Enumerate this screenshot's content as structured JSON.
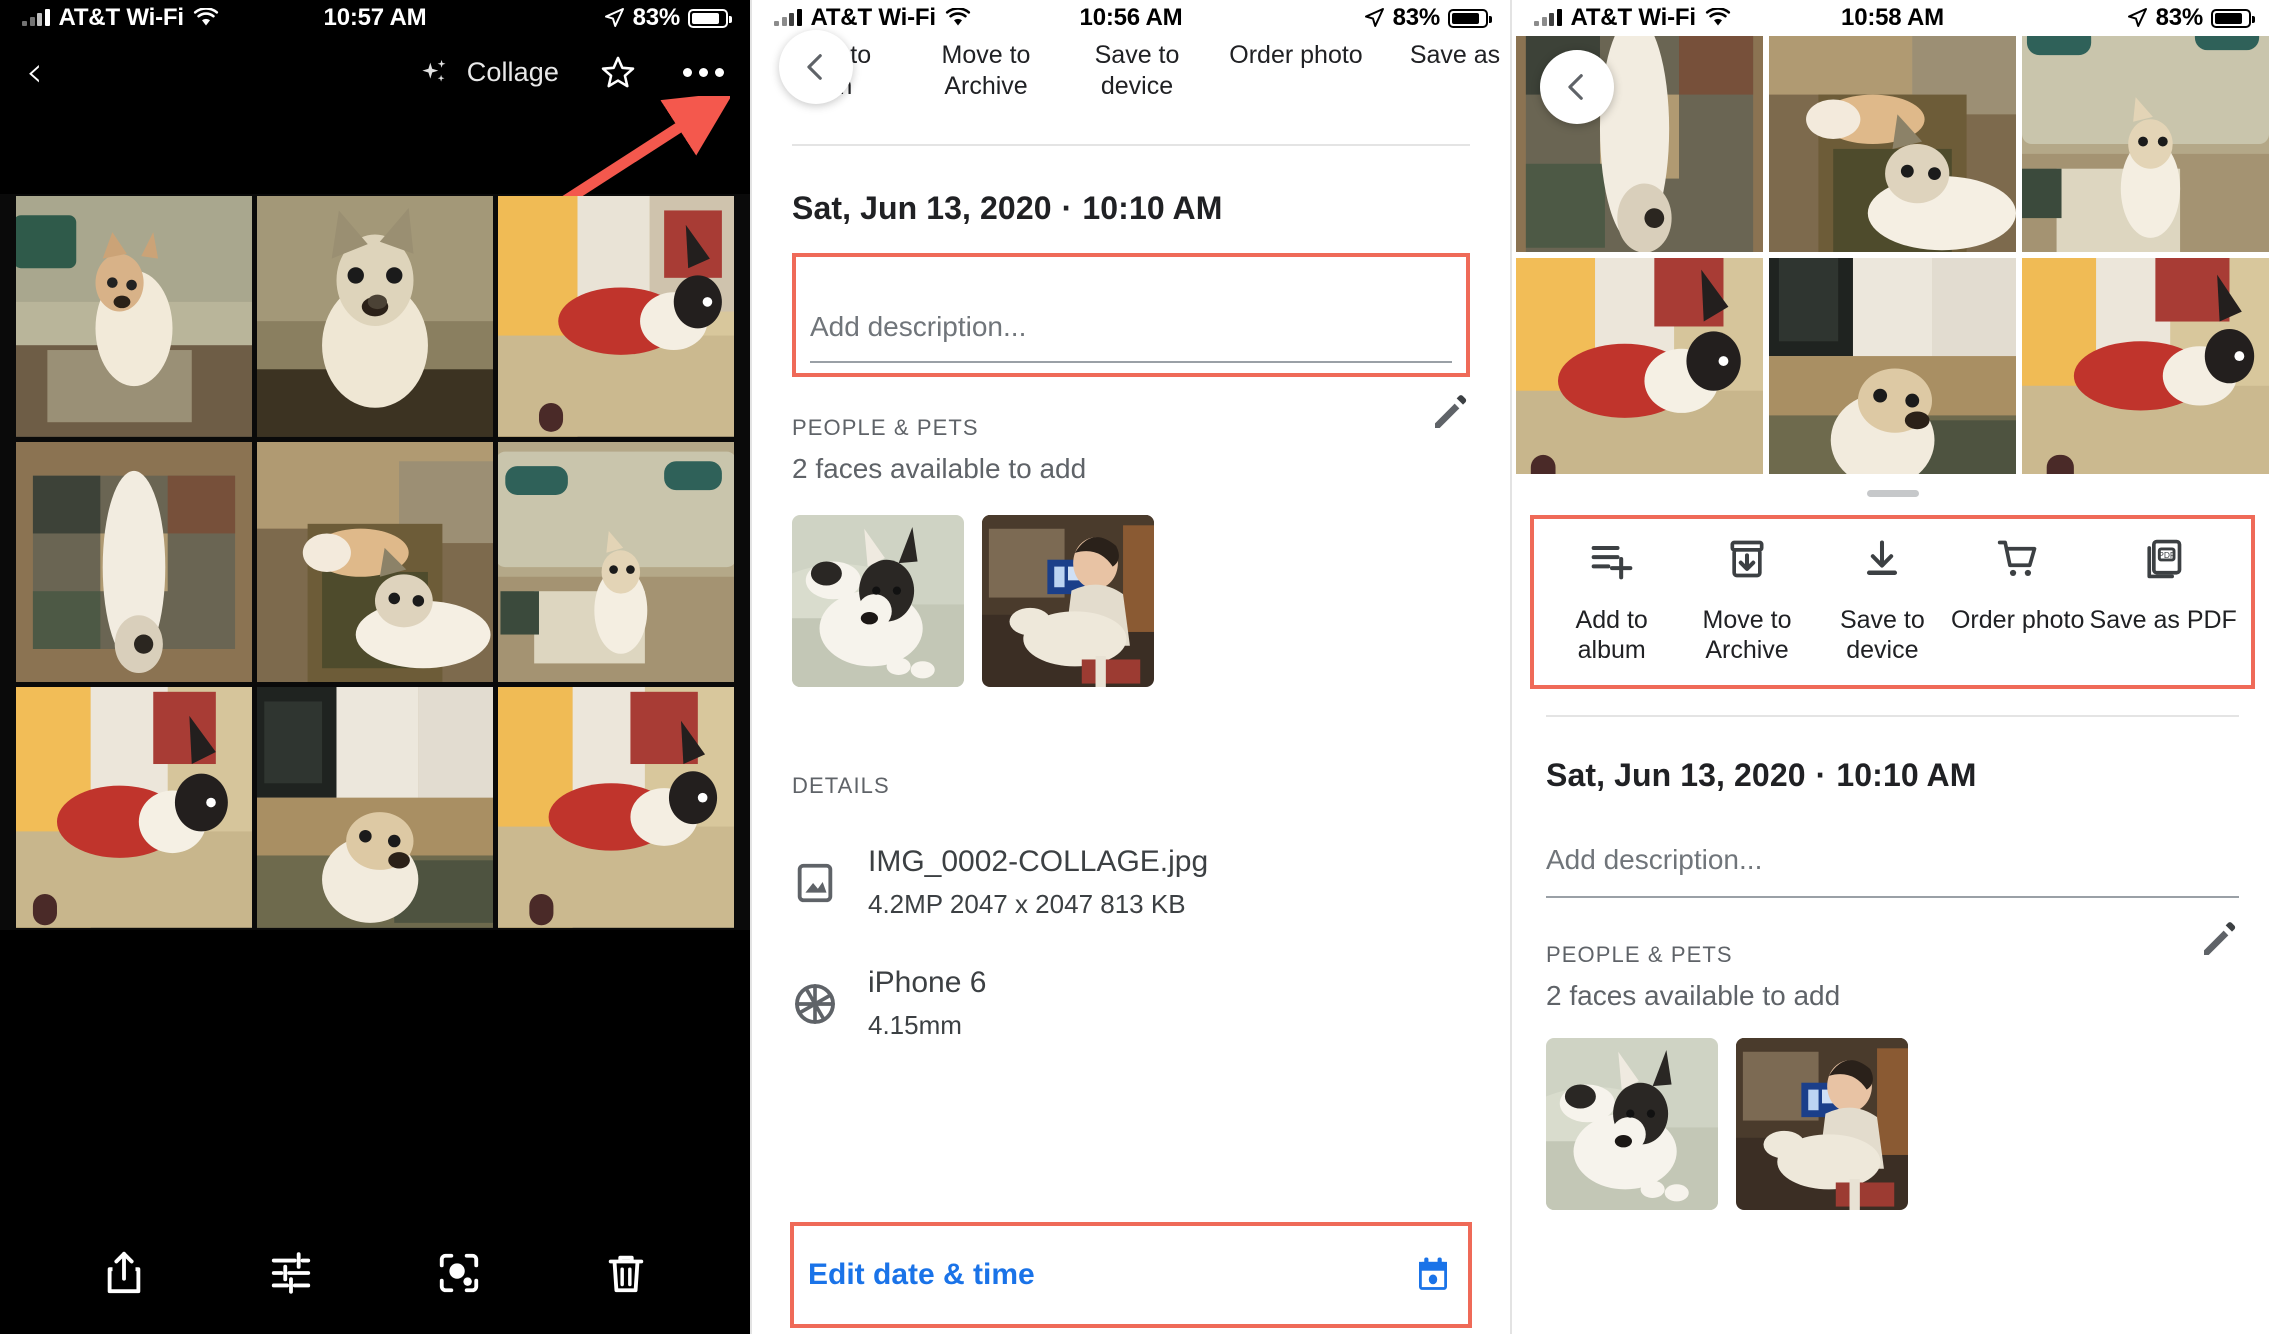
{
  "panel1": {
    "status": {
      "carrier": "AT&T Wi-Fi",
      "time": "10:57 AM",
      "battery": "83%"
    },
    "topbar": {
      "back_icon": "chevron-left-icon",
      "sparkle_icon": "sparkle-icon",
      "title": "Collage",
      "star_icon": "star-outline-icon",
      "more_icon": "more-horizontal-icon"
    },
    "annotation": {
      "arrow_color": "#f4584d",
      "points_to": "more-horizontal-icon"
    },
    "toolbar": {
      "share_label": "Share",
      "edit_label": "Edit",
      "lens_label": "Lens",
      "delete_label": "Delete"
    }
  },
  "panel2": {
    "status": {
      "carrier": "AT&T Wi-Fi",
      "time": "10:56 AM",
      "battery": "83%"
    },
    "actions": [
      {
        "label": "Add to\nalbum",
        "line1": "Add to",
        "line2": "um"
      },
      {
        "label": "Move to Archive",
        "line1": "Move to",
        "line2": "Archive"
      },
      {
        "label": "Save to device",
        "line1": "Save to",
        "line2": "device"
      },
      {
        "label": "Order photo",
        "line1": "Order photo",
        "line2": ""
      },
      {
        "label": "Save as PDF",
        "line1": "Save as",
        "line2": ""
      }
    ],
    "back_icon": "chevron-left-icon",
    "datetime": {
      "date": "Sat, Jun 13, 2020",
      "separator": "·",
      "time": "10:10 AM"
    },
    "description_placeholder": "Add description...",
    "people_pets": {
      "label": "PEOPLE & PETS",
      "subtitle": "2 faces available to add",
      "edit_icon": "pencil-icon",
      "faces": [
        "face-thumbnail-dog",
        "face-thumbnail-person"
      ]
    },
    "details": {
      "label": "DETAILS",
      "rows": [
        {
          "icon": "image-icon",
          "title": "IMG_0002-COLLAGE.jpg",
          "subtitle": "4.2MP   2047 x 2047   813 KB"
        },
        {
          "icon": "aperture-icon",
          "title": "iPhone 6",
          "subtitle": "4.15mm"
        }
      ]
    },
    "edit_date_time": {
      "label": "Edit date & time",
      "icon": "calendar-icon",
      "color": "#1a73e8"
    },
    "highlight_color": "#ef6a58"
  },
  "panel3": {
    "status": {
      "carrier": "AT&T Wi-Fi",
      "time": "10:58 AM",
      "battery": "83%"
    },
    "back_icon": "chevron-left-icon",
    "grabber": "drag-handle",
    "actions": [
      {
        "icon": "playlist-add-icon",
        "line1": "Add to",
        "line2": "album"
      },
      {
        "icon": "archive-icon",
        "line1": "Move to",
        "line2": "Archive"
      },
      {
        "icon": "download-icon",
        "line1": "Save to",
        "line2": "device"
      },
      {
        "icon": "shopping-cart-icon",
        "line1": "Order photo",
        "line2": ""
      },
      {
        "icon": "pdf-icon",
        "line1": "Save as PDF",
        "line2": ""
      }
    ],
    "datetime": {
      "date": "Sat, Jun 13, 2020",
      "separator": "·",
      "time": "10:10 AM"
    },
    "description_placeholder": "Add description...",
    "people_pets": {
      "label": "PEOPLE & PETS",
      "subtitle": "2 faces available to add",
      "edit_icon": "pencil-icon"
    },
    "highlight_color": "#ef6a58"
  }
}
